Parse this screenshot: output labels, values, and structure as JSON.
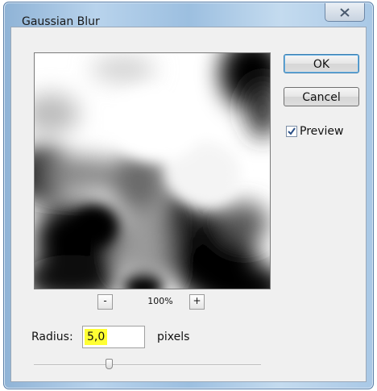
{
  "window": {
    "title": "Gaussian Blur"
  },
  "preview": {
    "zoom_out_label": "-",
    "zoom_level": "100%",
    "zoom_in_label": "+"
  },
  "buttons": {
    "ok_label": "OK",
    "cancel_label": "Cancel"
  },
  "preview_toggle": {
    "label": "Preview",
    "checked": true
  },
  "radius": {
    "label": "Radius:",
    "value": "5,0",
    "unit": "pixels",
    "slider_fraction": 0.33
  },
  "icons": {
    "close": "close-icon",
    "check": "check-icon"
  },
  "colors": {
    "value_highlight": "#ffff33",
    "default_button_border": "#3c7fb1"
  }
}
